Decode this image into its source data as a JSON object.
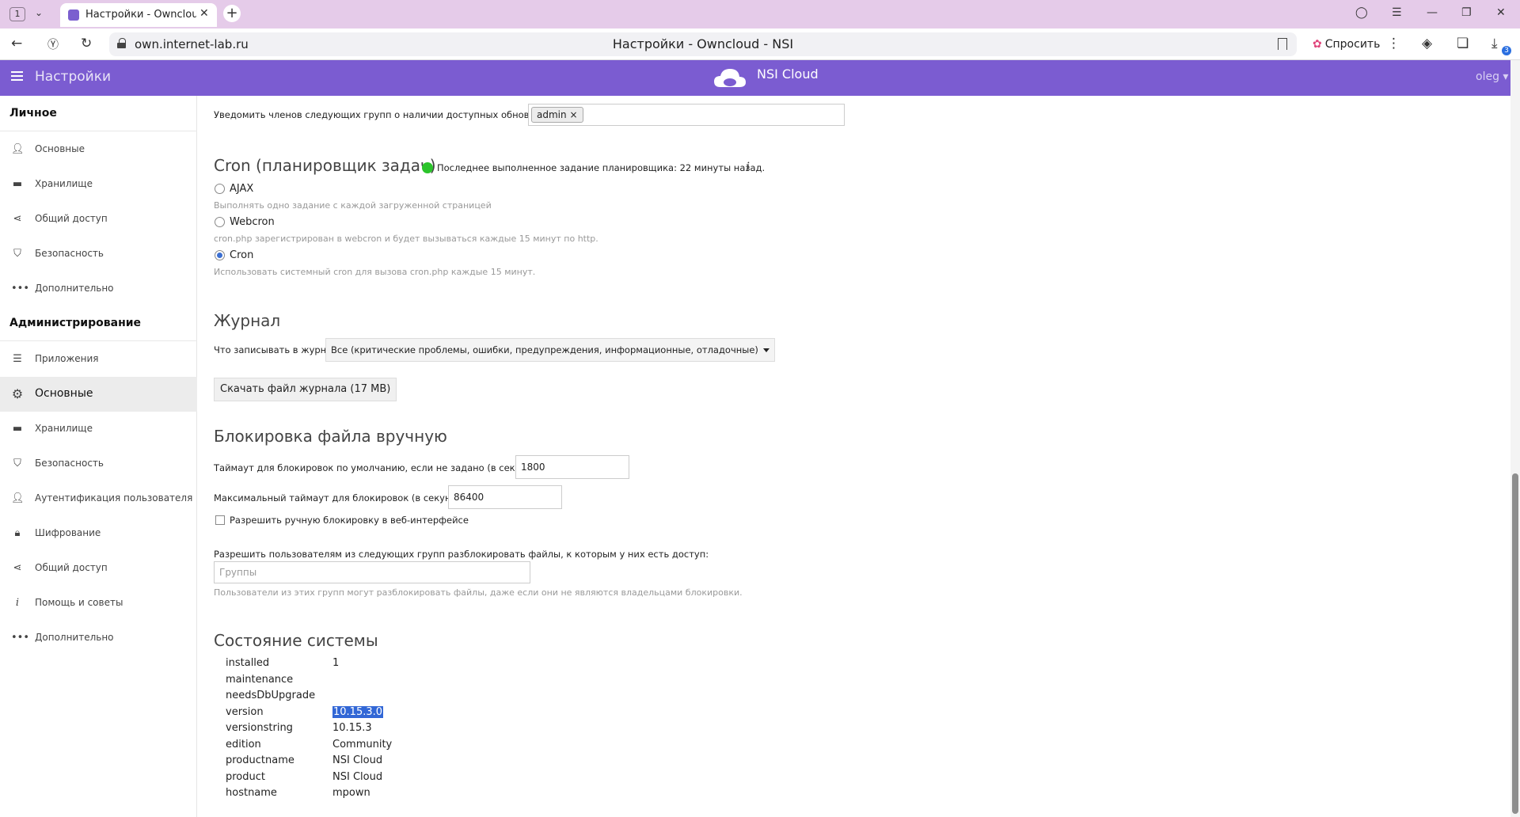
{
  "browser": {
    "tab_count": "1",
    "tab_title": "Настройки - Owncloud",
    "url": "own.internet-lab.ru",
    "page_title": "Настройки - Owncloud - NSI",
    "ask_label": "Спросить",
    "downloads_badge": "3"
  },
  "header": {
    "app_title": "Настройки",
    "brand": "NSI Cloud",
    "user": "oleg"
  },
  "sidebar": {
    "personal_title": "Личное",
    "personal_items": [
      {
        "label": "Основные",
        "icon": "person-icon"
      },
      {
        "label": "Хранилище",
        "icon": "folder-icon"
      },
      {
        "label": "Общий доступ",
        "icon": "share-icon"
      },
      {
        "label": "Безопасность",
        "icon": "shield-icon"
      },
      {
        "label": "Дополнительно",
        "icon": "more-icon"
      }
    ],
    "admin_title": "Администрирование",
    "admin_items": [
      {
        "label": "Приложения",
        "icon": "list-icon"
      },
      {
        "label": "Основные",
        "icon": "gear-icon",
        "active": true
      },
      {
        "label": "Хранилище",
        "icon": "folder-icon"
      },
      {
        "label": "Безопасность",
        "icon": "shield-icon"
      },
      {
        "label": "Аутентификация пользователя",
        "icon": "person-icon"
      },
      {
        "label": "Шифрование",
        "icon": "lock-icon"
      },
      {
        "label": "Общий доступ",
        "icon": "share-icon"
      },
      {
        "label": "Помощь и советы",
        "icon": "info-icon"
      },
      {
        "label": "Дополнительно",
        "icon": "more-icon"
      }
    ]
  },
  "updates": {
    "notify_label": "Уведомить членов следующих групп о наличии доступных обновлений:",
    "group_tag": "admin"
  },
  "cron": {
    "title": "Cron (планировщик задач)",
    "status": "Последнее выполненное задание планировщика: 22 минуты назад.",
    "options": [
      {
        "label": "AJAX",
        "hint": "Выполнять одно задание с каждой загруженной страницей",
        "checked": false
      },
      {
        "label": "Webcron",
        "hint": "cron.php зарегистрирован в webcron и будет вызываться каждые 15 минут по http.",
        "checked": false
      },
      {
        "label": "Cron",
        "hint": "Использовать системный cron для вызова cron.php каждые 15 минут.",
        "checked": true
      }
    ]
  },
  "log": {
    "title": "Журнал",
    "level_label": "Что записывать в журнал",
    "level_value": "Все (критические проблемы, ошибки, предупреждения, информационные, отладочные)",
    "download_button": "Скачать файл журнала (17 MB)"
  },
  "locking": {
    "title": "Блокировка файла вручную",
    "default_timeout_label": "Таймаут для блокировок по умолчанию, если не задано (в секундах)",
    "default_timeout_value": "1800",
    "max_timeout_label": "Максимальный таймаут для блокировок (в секундах)",
    "max_timeout_value": "86400",
    "allow_manual_label": "Разрешить ручную блокировку в веб-интерфейсе",
    "unlock_groups_label": "Разрешить пользователям из следующих групп разблокировать файлы, к которым у них есть доступ:",
    "groups_placeholder": "Группы",
    "groups_hint": "Пользователи из этих групп могут разблокировать файлы, даже если они не являются владельцами блокировки."
  },
  "system_status": {
    "title": "Состояние системы",
    "rows": [
      {
        "key": "installed",
        "value": "1"
      },
      {
        "key": "maintenance",
        "value": ""
      },
      {
        "key": "needsDbUpgrade",
        "value": ""
      },
      {
        "key": "version",
        "value": "10.15.3.0"
      },
      {
        "key": "versionstring",
        "value": "10.15.3"
      },
      {
        "key": "edition",
        "value": "Community"
      },
      {
        "key": "productname",
        "value": "NSI Cloud"
      },
      {
        "key": "product",
        "value": "NSI Cloud"
      },
      {
        "key": "hostname",
        "value": "mpown"
      }
    ]
  }
}
